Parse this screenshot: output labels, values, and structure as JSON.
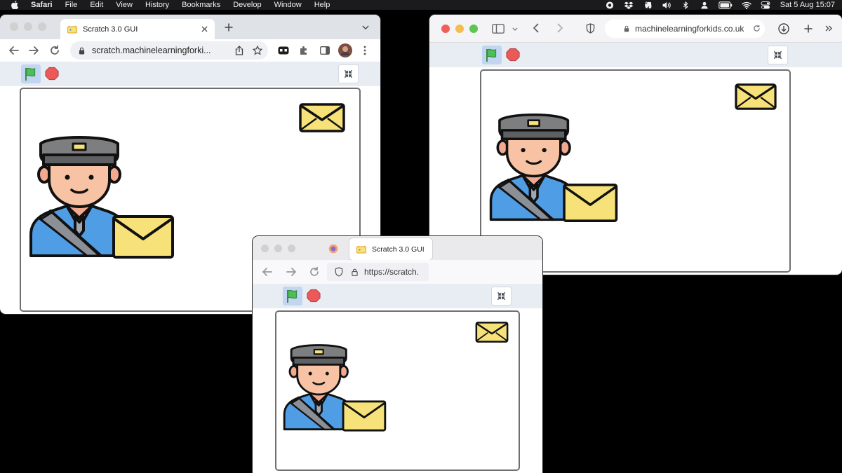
{
  "menubar": {
    "app": "Safari",
    "items": [
      "File",
      "Edit",
      "View",
      "History",
      "Bookmarks",
      "Develop",
      "Window",
      "Help"
    ],
    "clock": "Sat 5 Aug  15:07"
  },
  "chrome": {
    "tab_title": "Scratch 3.0 GUI",
    "url": "scratch.machinelearningforki..."
  },
  "safari": {
    "url": "machinelearningforkids.co.uk"
  },
  "firefox": {
    "tab_title": "Scratch 3.0 GUI",
    "url": "https://scratch."
  },
  "colors": {
    "stage_border": "#6f6f72",
    "flag_green": "#4cbf56",
    "stop_red": "#ec5959",
    "envelope_fill": "#f7e27a",
    "uniform_blue": "#4f9de4",
    "cap_grey": "#7d7e80",
    "skin": "#f7c3a4"
  }
}
